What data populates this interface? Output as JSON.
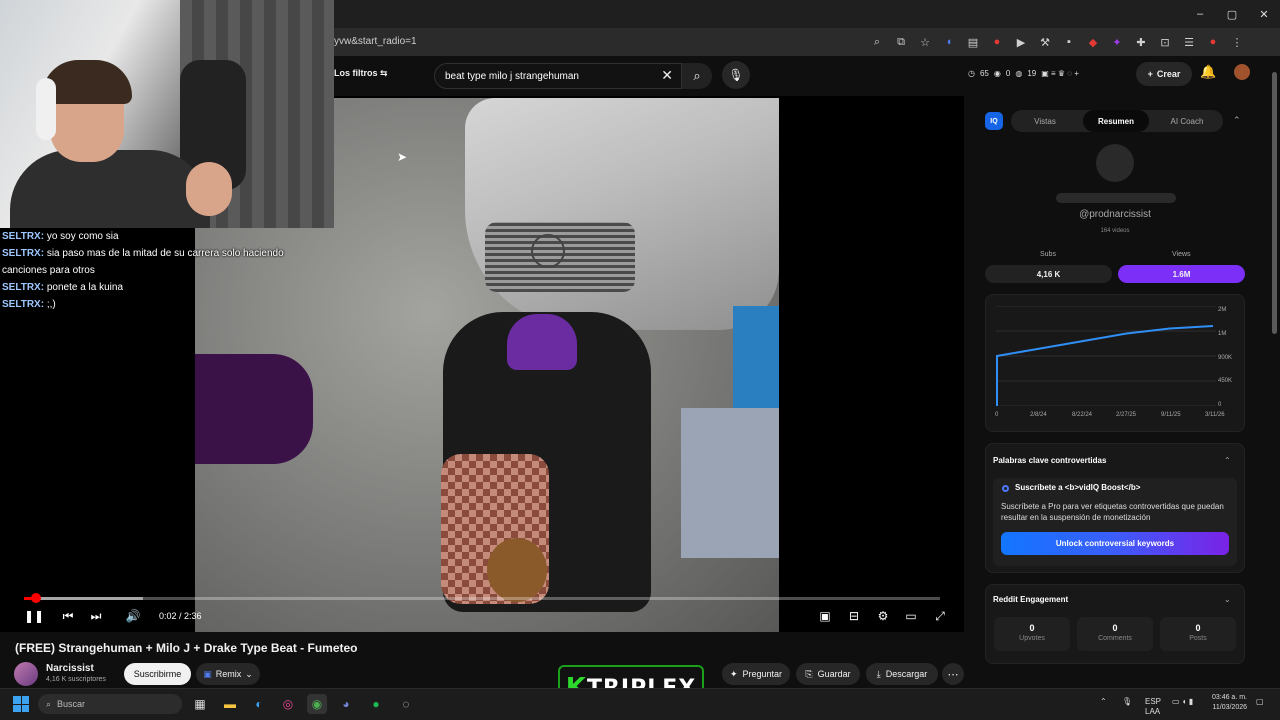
{
  "browser": {
    "url_fragment": "yvw&start_radio=1",
    "window_controls": [
      "–",
      "▢",
      "✕"
    ]
  },
  "header": {
    "filters_label": "Los filtros",
    "search_value": "beat type milo j strangehuman",
    "stats": [
      "65",
      "0",
      "19"
    ],
    "create_label": "Crear"
  },
  "stream_overlay": {
    "chat": [
      {
        "user": "SELTRX:",
        "text": "yo soy como sia"
      },
      {
        "user": "SELTRX:",
        "text": "sia paso mas de la mitad de su carrera solo haciendo canciones para otros"
      },
      {
        "user": "SELTRX:",
        "text": "ponete a la kuina"
      },
      {
        "user": "SELTRX:",
        "text": ";,)"
      }
    ],
    "logo": {
      "k": "K",
      "text": "TRIPLEX"
    }
  },
  "player": {
    "time": "0:02 / 2:36",
    "progress_fraction": 0.013,
    "buffered_fraction": 0.13
  },
  "video": {
    "title": "(FREE) Strangehuman + Milo J + Drake Type Beat - Fumeteo",
    "channel": "Narcissist",
    "subscribers": "4,16 K suscriptores",
    "subscribe_label": "Suscribirme",
    "remix_label": "Remix",
    "actions": {
      "ask": "Preguntar",
      "save": "Guardar",
      "download": "Descargar"
    }
  },
  "vidiq": {
    "badge": "IQ",
    "tabs": [
      "Vistas",
      "Resumen",
      "AI Coach"
    ],
    "active_tab": "Resumen",
    "handle": "@prodnarcissist",
    "videos_count": "164 videos",
    "subs_label": "Subs",
    "views_label": "Views",
    "subs_value": "4,16 K",
    "views_value": "1.6M",
    "accent": "#7b2ff7",
    "chart_data": {
      "type": "line",
      "x": [
        "0",
        "2/8/24",
        "8/22/24",
        "2/27/25",
        "9/11/25",
        "3/11/26"
      ],
      "y_ticks": [
        "2M",
        "1M",
        "900K",
        "450K",
        "0"
      ],
      "series": [
        {
          "values": [
            0,
            1000000,
            1150000,
            1300000,
            1450000,
            1550000,
            1600000
          ]
        }
      ]
    },
    "controversial": {
      "title": "Palabras clave controvertidas",
      "promo_head": "Suscríbete a <b>vidIQ Boost</b>",
      "promo_body": "Suscríbete a Pro para ver etiquetas controvertidas que puedan resultar en la suspensión de monetización",
      "unlock_label": "Unlock controversial keywords"
    },
    "reddit": {
      "title": "Reddit Engagement",
      "items": [
        {
          "value": "0",
          "label": "Upvotes"
        },
        {
          "value": "0",
          "label": "Comments"
        },
        {
          "value": "0",
          "label": "Posts"
        }
      ]
    }
  },
  "taskbar": {
    "search_placeholder": "Buscar",
    "lang": "ESP",
    "region": "LAA",
    "time": "03:46 a. m.",
    "date": "11/03/2026"
  }
}
